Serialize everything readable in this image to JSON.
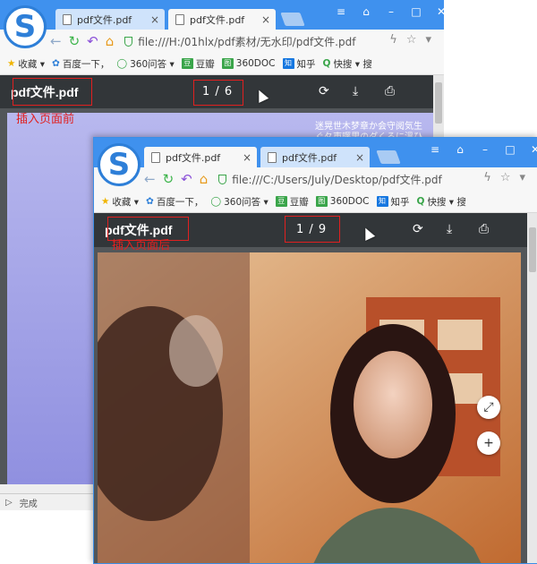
{
  "back": {
    "tabs": [
      {
        "label": "pdf文件.pdf",
        "close": "×",
        "active": false
      },
      {
        "label": "pdf文件.pdf",
        "close": "×",
        "active": true
      }
    ],
    "url": "file:///H:/01hlx/pdf素材/无水印/pdf文件.pdf",
    "pdf_title": "pdf文件.pdf",
    "page_indicator": "1 / 6",
    "annotation": "插入页面前",
    "status": "完成",
    "deco_text": [
      "迷晃世木梦章か会守阅気生",
      "ぐ夂東曙里のダくるに溫ひ"
    ]
  },
  "front": {
    "tabs": [
      {
        "label": "pdf文件.pdf",
        "close": "×",
        "active": true
      },
      {
        "label": "pdf文件.pdf",
        "close": "×",
        "active": false
      }
    ],
    "url": "file:///C:/Users/July/Desktop/pdf文件.pdf",
    "pdf_title": "pdf文件.pdf",
    "page_indicator": "1 / 9",
    "annotation": "插入页面后"
  },
  "bookmarks": [
    {
      "icon": "star-icon",
      "label": "收藏 ▾"
    },
    {
      "icon": "paw-icon",
      "label": "百度一下，"
    },
    {
      "icon": "360-icon",
      "label": "360问答 ▾"
    },
    {
      "icon": "douban-icon",
      "badge": "豆",
      "label": "豆瓣"
    },
    {
      "icon": "360doc-icon",
      "badge": "图",
      "label": "360DOC"
    },
    {
      "icon": "zhihu-icon",
      "badge": "知",
      "label": "知乎"
    },
    {
      "icon": "kuaisou-icon",
      "label": "快搜 ▾ 搜"
    }
  ],
  "colors": {
    "titlebar": "#3f91ee",
    "pdf_toolbar": "#323639",
    "annotation_red": "#e02020"
  }
}
